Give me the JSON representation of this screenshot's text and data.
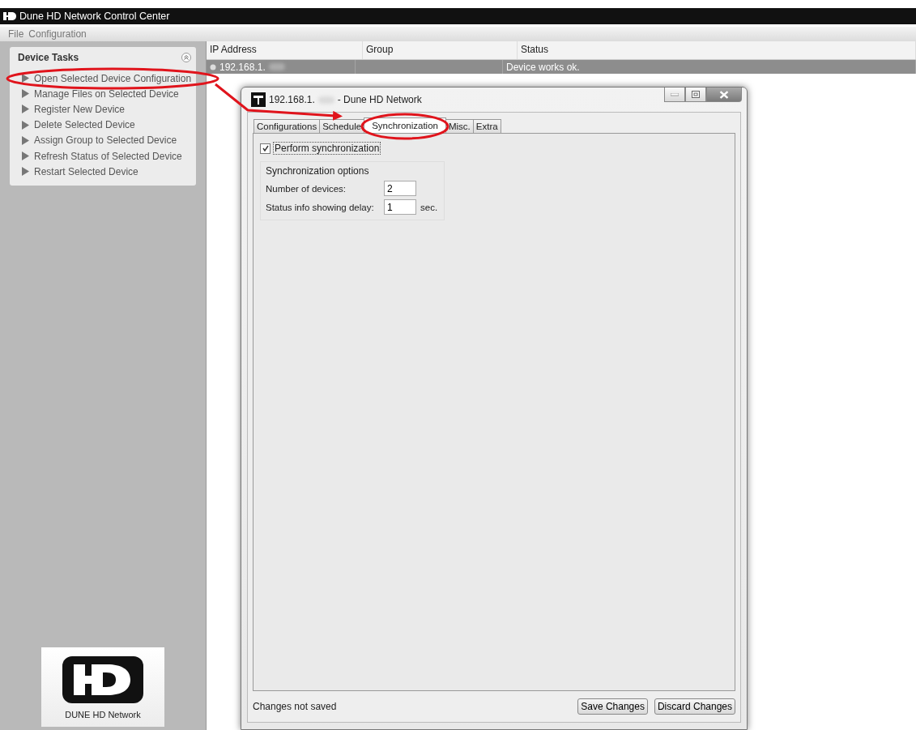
{
  "window": {
    "title": "Dune HD Network Control Center"
  },
  "menu": [
    "File",
    "Configuration"
  ],
  "device_tasks": {
    "title": "Device Tasks",
    "expanded": true,
    "items": [
      {
        "label": "Open Selected Device Configuration"
      },
      {
        "label": "Manage Files on Selected Device"
      },
      {
        "label": "Register New Device"
      },
      {
        "label": "Delete Selected Device"
      },
      {
        "label": "Assign Group to Selected Device"
      },
      {
        "label": "Refresh Status of Selected Device"
      },
      {
        "label": "Restart Selected Device"
      }
    ]
  },
  "logo": {
    "caption": "DUNE HD Network"
  },
  "table": {
    "columns": [
      "IP Address",
      "Group",
      "Status"
    ],
    "rows": [
      {
        "ip": "192.168.1.",
        "group": "",
        "status": "Device works ok.",
        "selected": true
      }
    ]
  },
  "dialog": {
    "title_ip": "192.168.1.",
    "title": "- Dune HD Network",
    "tabs": [
      {
        "label": "Configurations",
        "selected": false
      },
      {
        "label": "Schedule",
        "selected": false
      },
      {
        "label": "Synchronization",
        "selected": true
      },
      {
        "label": "Misc.",
        "selected": false
      },
      {
        "label": "Extra",
        "selected": false
      }
    ],
    "perform": {
      "label": "Perform synchronization",
      "checked": true
    },
    "group_title": "Synchronization options",
    "fields": [
      {
        "label": "Number of devices:",
        "value": "2"
      },
      {
        "label": "Status info showing delay:",
        "value": "1",
        "unit": "sec."
      }
    ],
    "status": "Changes not saved",
    "buttons": [
      "Save Changes",
      "Discard Changes"
    ]
  },
  "annotations": [
    {
      "kind": "ellipse"
    },
    {
      "kind": "ellipse"
    },
    {
      "kind": "arrow"
    }
  ]
}
